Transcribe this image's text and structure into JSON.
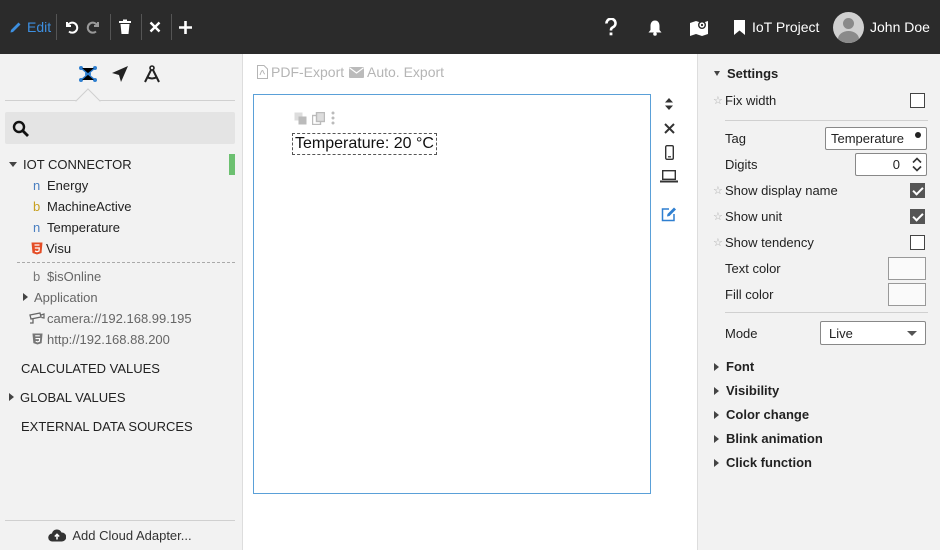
{
  "toolbar": {
    "edit_label": "Edit",
    "project_label": "IoT Project",
    "user_name": "John Doe"
  },
  "left": {
    "search_placeholder": "",
    "iot_connector": {
      "title": "IOT CONNECTOR",
      "items": [
        {
          "prefix": "n",
          "label": "Energy"
        },
        {
          "prefix": "b",
          "label": "MachineActive"
        },
        {
          "prefix": "n",
          "label": "Temperature"
        },
        {
          "prefix": "html5",
          "label": "Visu"
        }
      ],
      "extra": [
        {
          "prefix": "b",
          "label": "$isOnline"
        },
        {
          "label": "Application"
        },
        {
          "label": "camera://192.168.99.195"
        },
        {
          "label": "http://192.168.88.200"
        }
      ]
    },
    "groups": [
      "CALCULATED VALUES",
      "GLOBAL VALUES",
      "EXTERNAL DATA SOURCES"
    ],
    "add_cloud_label": "Add Cloud Adapter..."
  },
  "center": {
    "pdf_export_label": "PDF-Export",
    "auto_export_label": "Auto. Export",
    "widget_text": "Temperature: 20 °C"
  },
  "right": {
    "settings_title": "Settings",
    "fix_width": {
      "label": "Fix width",
      "checked": false
    },
    "tag": {
      "label": "Tag",
      "value": "Temperature"
    },
    "digits": {
      "label": "Digits",
      "value": "0"
    },
    "show_display_name": {
      "label": "Show display name",
      "checked": true
    },
    "show_unit": {
      "label": "Show unit",
      "checked": true
    },
    "show_tendency": {
      "label": "Show tendency",
      "checked": false
    },
    "text_color": {
      "label": "Text color"
    },
    "fill_color": {
      "label": "Fill color"
    },
    "mode": {
      "label": "Mode",
      "value": "Live"
    },
    "sections": [
      "Font",
      "Visibility",
      "Color change",
      "Blink animation",
      "Click function"
    ]
  },
  "colors": {
    "topbar": "#2b2b2b",
    "accent_blue": "#3d8fe0",
    "canvas_border": "#5aa0d8",
    "connected_green": "#6cc070"
  }
}
